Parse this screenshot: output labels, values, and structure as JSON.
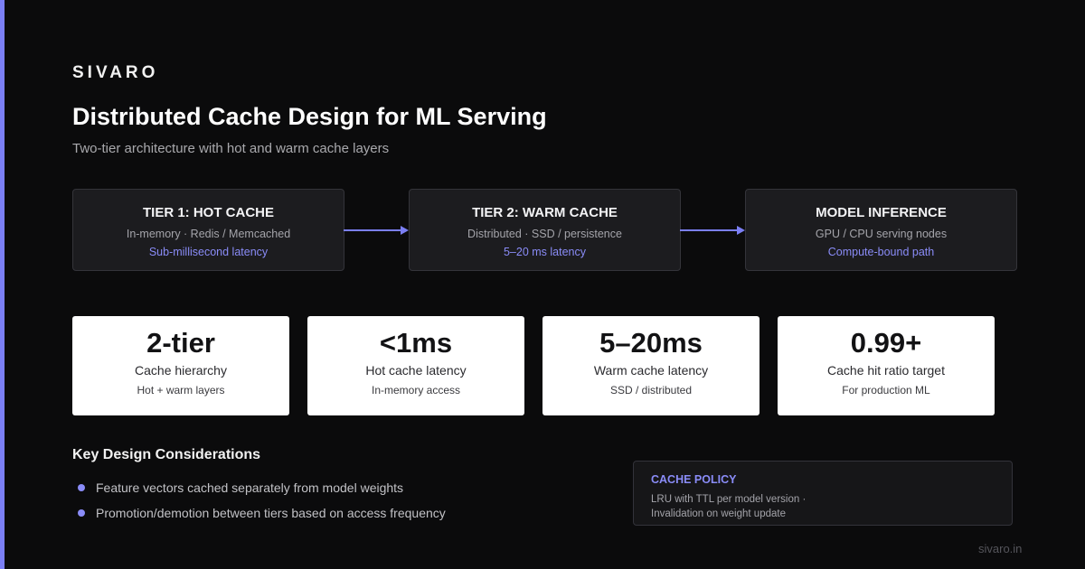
{
  "brand": "SIVARO",
  "title": "Distributed Cache Design for ML Serving",
  "subtitle": "Two-tier architecture with hot and warm cache layers",
  "colors": {
    "accent": "#7b7ff5",
    "background": "#0b0b0c"
  },
  "tiers": [
    {
      "title": "TIER 1: HOT CACHE",
      "desc": "In-memory · Redis / Memcached",
      "note": "Sub-millisecond latency"
    },
    {
      "title": "TIER 2: WARM CACHE",
      "desc": "Distributed · SSD / persistence",
      "note": "5–20 ms latency"
    },
    {
      "title": "MODEL INFERENCE",
      "desc": "GPU / CPU serving nodes",
      "note": "Compute-bound path"
    }
  ],
  "stats": [
    {
      "value": "2-tier",
      "label": "Cache hierarchy",
      "sub": "Hot + warm layers"
    },
    {
      "value": "<1ms",
      "label": "Hot cache latency",
      "sub": "In-memory access"
    },
    {
      "value": "5–20ms",
      "label": "Warm cache latency",
      "sub": "SSD / distributed"
    },
    {
      "value": "0.99+",
      "label": "Cache hit ratio target",
      "sub": "For production ML"
    }
  ],
  "considerations": {
    "title": "Key Design Considerations",
    "items": [
      "Feature vectors cached separately from model weights",
      "Promotion/demotion between tiers based on access frequency"
    ]
  },
  "policy": {
    "title": "CACHE POLICY",
    "text": "LRU with TTL per model version · Invalidation on weight update"
  },
  "footer_url": "sivaro.in"
}
